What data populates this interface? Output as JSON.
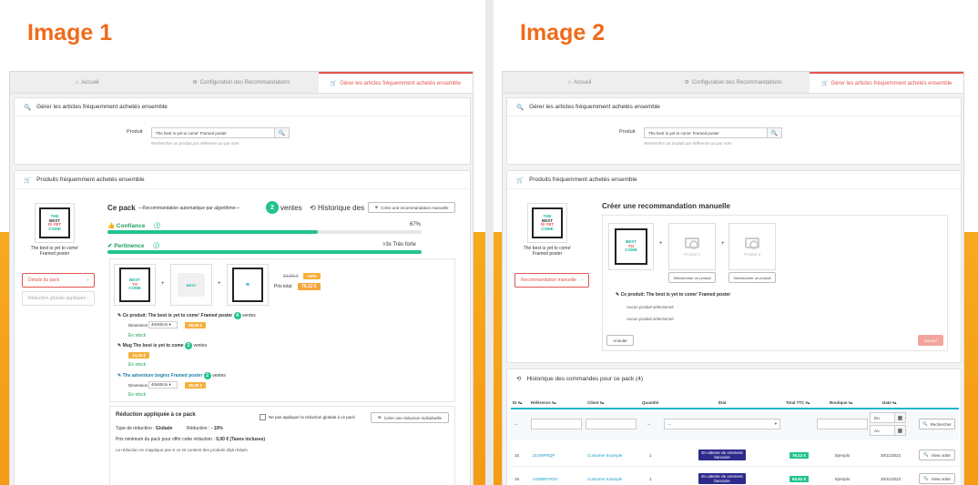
{
  "labels": {
    "image1": "Image 1",
    "image2": "Image 2"
  },
  "tabs": [
    "Accueil",
    "Configuration des Recommandations",
    "Gérer les articles fréquemment achetés ensemble"
  ],
  "manage": {
    "title": "Gérer les articles fréquemment achetés ensemble",
    "product_label": "Produit",
    "product_value": "The best is yet to come' Framed poster",
    "help": "Rechercher un produit par référence ou par nom"
  },
  "fbt": {
    "title": "Produits fréquemment achetés ensemble",
    "product_name": "The best is yet to come' Framed poster"
  },
  "poster": {
    "l1": "THE",
    "l2": "BEST",
    "l3": "IS YET",
    "l4": "TO",
    "l5": "COME"
  },
  "sidebar": {
    "details": "Détails du pack",
    "reduction": "Réduction globale appliquée",
    "manual": "Recommandation manuelle"
  },
  "pack": {
    "title": "Ce pack",
    "subtitle": "—Recommandation automatique par algorithme—",
    "count": "2",
    "ventes": "ventes",
    "history": "Historique des",
    "create_manual": "Créer une recommandation manuelle",
    "confiance": "Confiance",
    "confiance_value": "67%",
    "pertinence": "Pertinence",
    "pertinence_value": ">3x Très forte",
    "old_price": "81,50 €",
    "discount": "-10%",
    "prix_total": "Prix total",
    "total": "76,12 €"
  },
  "items": [
    {
      "title": "Ce produit: The best is yet to come' Framed poster",
      "count": "4",
      "ventes": "ventes",
      "dim_label": "Dimension",
      "dim": "40x60cm",
      "price": "35,08 €",
      "stock": "En stock"
    },
    {
      "title": "Mug The best is yet to come",
      "count": "2",
      "ventes": "ventes",
      "price": "14,40 €",
      "stock": "En stock"
    },
    {
      "title": "The adventure begins Framed poster",
      "count": "2",
      "ventes": "ventes",
      "dim_label": "Dimension",
      "dim": "40x60cm",
      "price": "35,08 €",
      "stock": "En stock"
    }
  ],
  "reduction": {
    "title": "Réduction appliquée à ce pack",
    "no_global": "Ne pas appliquer la réduction globale à ce pack",
    "create_btn": "Créer une réduction individuelle",
    "type_label": "Type de réduction :",
    "type": "Globale",
    "red_label": "Réduction :",
    "red": "- 10%",
    "min_label": "Prix minimum du pack pour offrir cette réduction :",
    "min": "0,00 € (Taxes incluses)",
    "note": "La réduction ne s'applique pas si ce lot contient des produits déjà réduits"
  },
  "manual": {
    "title": "Créer une recommandation manuelle",
    "p2": "Produit 2",
    "p3": "Produit 3",
    "select": "Sélectionner un produit",
    "this_product": "Ce produit: The best is yet to come' Framed poster",
    "none1": "Aucun produit sélectionné",
    "none2": "Aucun produit sélectionné",
    "cancel": "Annuler",
    "save": "Sauver"
  },
  "orders": {
    "title": "Historique des commandes pour ce pack (4)",
    "cols": [
      "ID",
      "Référence",
      "Client",
      "Quantité",
      "État",
      "Total TTC",
      "Boutique",
      "Date"
    ],
    "dash": "--",
    "du": "Du",
    "au": "Au",
    "search": "Rechercher",
    "rows": [
      {
        "id": "15",
        "ref": "ZLVMPRQP",
        "client": "Customer Example",
        "qty": "1",
        "state": "En attente de virement bancaire",
        "total": "76,12 €",
        "shop": "Ejemplo",
        "date": "30/11/2022",
        "view": "View order"
      },
      {
        "id": "15",
        "ref": "USBBBYRDV",
        "client": "Customer Example",
        "qty": "1",
        "state": "En attente de virement bancaire",
        "total": "83,91 €",
        "shop": "Ejemplo",
        "date": "30/11/2022",
        "view": "View order"
      }
    ]
  }
}
